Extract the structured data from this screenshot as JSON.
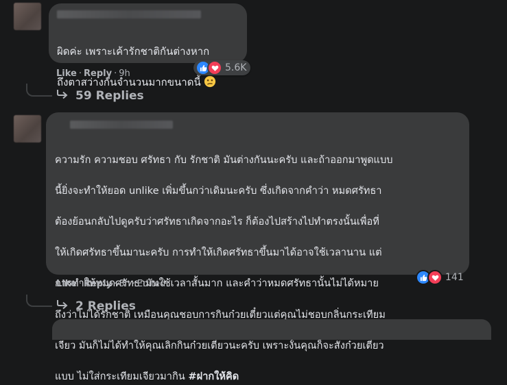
{
  "comments": [
    {
      "text_lines": [
        "ผิดค่ะ เพราะเค้ารักชาติกันต่างหาก",
        "ถึงตาสว่างกันจำนวนมากขนาดนี้"
      ],
      "emoji_icon": "confused-face-emoji",
      "like_label": "Like",
      "reply_label": "Reply",
      "time": "9h",
      "edited": "",
      "reaction_count": "5.6K",
      "replies_label": "59 Replies"
    },
    {
      "text_lines": [
        "ความรัก ความชอบ ศรัทธา กับ รักชาติ มันต่างกันนะครับ และถ้าออกมาพูดแบบ",
        "นี้ยิ่งจะทำให้ยอด unlike เพิ่มขึ้นกว่าเดิมนะครับ ซึ่งเกิดจากคำว่า หมดศรัทธา",
        "ต้องย้อนกลับไปดูครับว่าศรัทธาเกิดจากอะไร ก็ต้องไปสร้างไปทำตรงนั้นเพื่อที่",
        "ให้เกิดศรัทธาขึ้นมานะครับ การทำให้เกิดศรัทธาขึ้นมาได้อาจใช้เวลานาน แต่",
        "การทำให้หมดศรัทธามันใช้เวลาสั้นมาก และคำว่าหมดศรัทธานั้นไม่ได้หมาย",
        "ถึงว่าไม่ได้รักชาติ เหมือนคุณชอบการกินก๋วยเตี๋ยวแต่คุณไม่ชอบกลิ่นกระเทียม",
        "เจียว มันก็ไม่ได้ทำให้คุณเลิกกินก๋วยเตี๋ยวนะครับ เพราะงั้นคุณก็จะสั่งก๋วยเตี๋ยว",
        "แบบ ไม่ใส่กระเทียมเจียวมากิน"
      ],
      "hashtag": "#ฝากให้คิด",
      "like_label": "Like",
      "reply_label": "Reply",
      "time": "8h",
      "edited": "Edited",
      "reaction_count": "141",
      "replies_label": "2 Replies"
    }
  ],
  "icons": {
    "like": "thumbs-up-icon",
    "love": "heart-icon",
    "replies": "reply-arrow-icon"
  },
  "colors": {
    "background": "#18191a",
    "bubble": "#3a3b3c",
    "text": "#e4e6eb",
    "muted": "#b0b3b8",
    "like_blue": "#2d88ff",
    "love_red": "#f33e58"
  }
}
